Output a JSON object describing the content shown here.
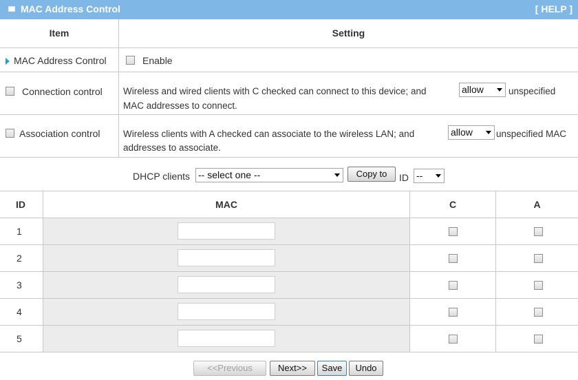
{
  "panel": {
    "title": "MAC Address Control",
    "help": "[ HELP ]"
  },
  "columns": {
    "item": "Item",
    "setting": "Setting"
  },
  "mac_control": {
    "label": "MAC Address Control",
    "enable_label": "Enable"
  },
  "connection": {
    "label": "Connection control",
    "text_before": "Wireless and wired clients with C checked can connect to this device; and",
    "select_value": "allow",
    "text_after": "unspecified",
    "text_line2": "MAC addresses to connect."
  },
  "association": {
    "label": "Association control",
    "text_before": "Wireless clients with A checked can associate to the wireless LAN; and",
    "select_value": "allow",
    "text_after": "unspecified MAC",
    "text_line2": "addresses to associate."
  },
  "dhcp": {
    "label": "DHCP clients",
    "select_value": "-- select one --",
    "copy_button": "Copy to",
    "id_label": "ID",
    "id_select_value": "--"
  },
  "table": {
    "headers": {
      "id": "ID",
      "mac": "MAC",
      "c": "C",
      "a": "A"
    },
    "rows": [
      {
        "id": "1",
        "mac": ""
      },
      {
        "id": "2",
        "mac": ""
      },
      {
        "id": "3",
        "mac": ""
      },
      {
        "id": "4",
        "mac": ""
      },
      {
        "id": "5",
        "mac": ""
      }
    ]
  },
  "buttons": {
    "previous": "<<Previous",
    "next": "Next>>",
    "save": "Save",
    "undo": "Undo"
  }
}
